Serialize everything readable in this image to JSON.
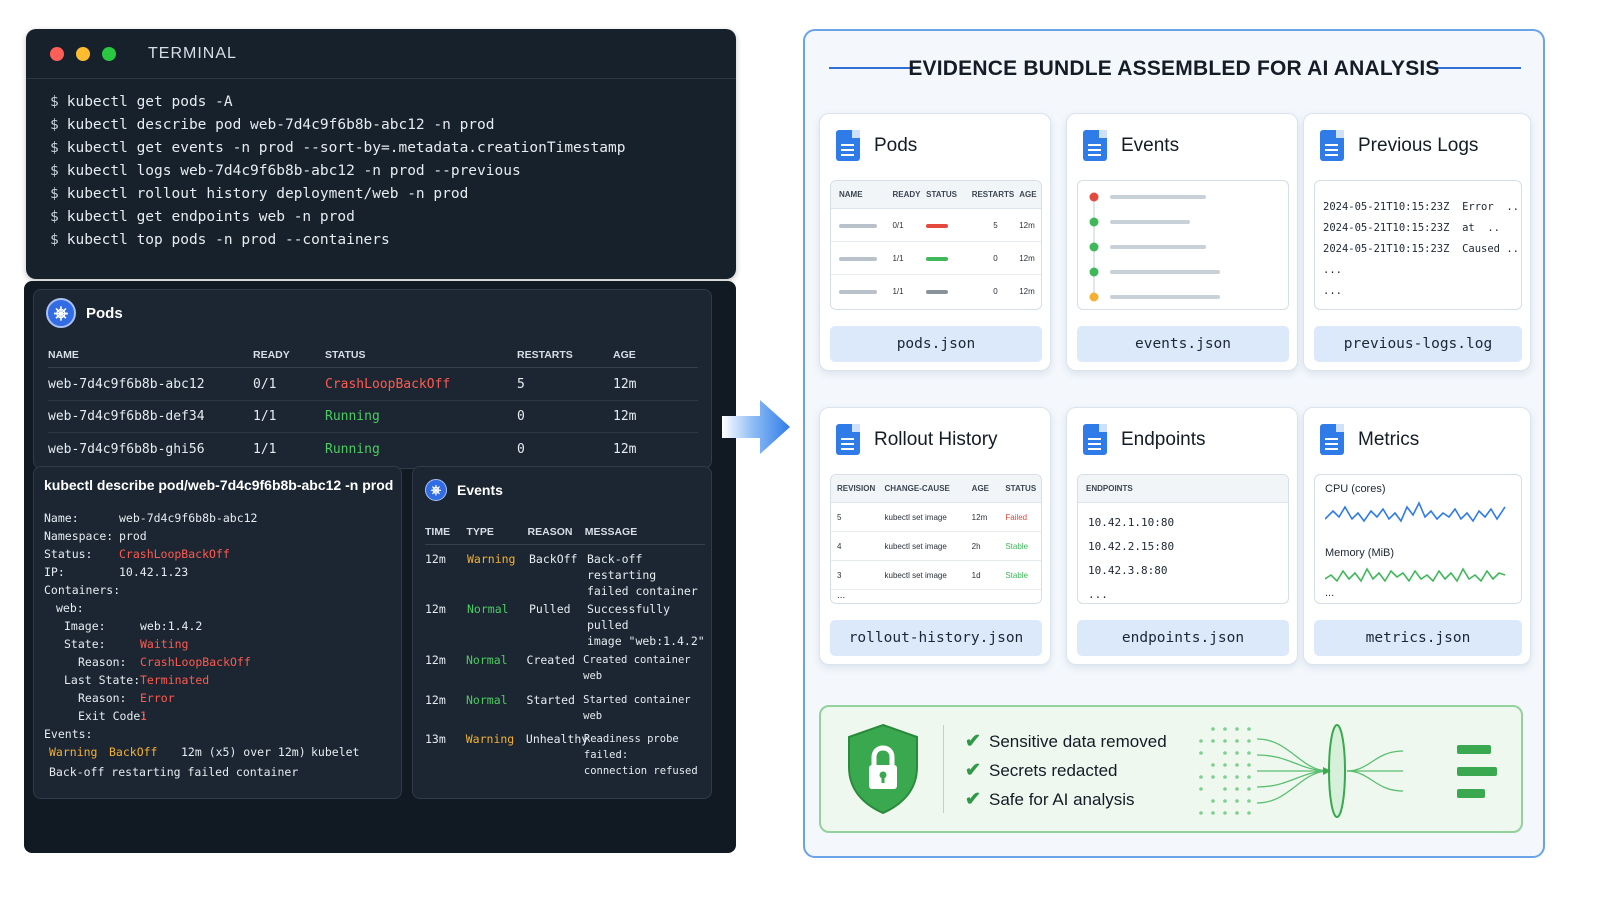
{
  "terminal": {
    "title": "TERMINAL",
    "prompt": "$",
    "commands": [
      "kubectl get pods -A",
      "kubectl describe pod web-7d4c9f6b8b-abc12 -n prod",
      "kubectl get events -n prod --sort-by=.metadata.creationTimestamp",
      "kubectl logs web-7d4c9f6b8b-abc12 -n prod --previous",
      "kubectl rollout history deployment/web -n prod",
      "kubectl get endpoints web -n prod",
      "kubectl top pods -n prod --containers"
    ]
  },
  "pods_panel": {
    "title": "Pods",
    "columns": [
      "NAME",
      "READY",
      "STATUS",
      "RESTARTS",
      "AGE"
    ],
    "rows": [
      {
        "name": "web-7d4c9f6b8b-abc12",
        "ready": "0/1",
        "status": "CrashLoopBackOff",
        "restarts": "5",
        "age": "12m"
      },
      {
        "name": "web-7d4c9f6b8b-def34",
        "ready": "1/1",
        "status": "Running",
        "restarts": "0",
        "age": "12m"
      },
      {
        "name": "web-7d4c9f6b8b-ghi56",
        "ready": "1/1",
        "status": "Running",
        "restarts": "0",
        "age": "12m"
      }
    ]
  },
  "describe_panel": {
    "title": "kubectl describe pod/web-7d4c9f6b8b-abc12 -n prod",
    "name_label": "Name:",
    "name": "web-7d4c9f6b8b-abc12",
    "namespace_label": "Namespace:",
    "namespace": "prod",
    "status_label": "Status:",
    "status": "CrashLoopBackOff",
    "ip_label": "IP:",
    "ip": "10.42.1.23",
    "containers_label": "Containers:",
    "container_name": "web:",
    "image_label": "Image:",
    "image": "web:1.4.2",
    "state_label": "State:",
    "state": "Waiting",
    "reason_label": "Reason:",
    "reason": "CrashLoopBackOff",
    "last_state_label": "Last State:",
    "last_state": "Terminated",
    "last_reason_label": "Reason:",
    "last_reason": "Error",
    "exit_code_label": "Exit Code:",
    "exit_code": "1",
    "events_label": "Events:",
    "event_type": "Warning",
    "event_reason": "BackOff",
    "event_age": "12m (x5) over 12m)",
    "event_from": "kubelet",
    "event_message": "Back-off restarting failed container"
  },
  "events_panel": {
    "title": "Events",
    "columns": [
      "TIME",
      "TYPE",
      "REASON",
      "MESSAGE"
    ],
    "rows": [
      {
        "time": "12m",
        "type": "Warning",
        "reason": "BackOff",
        "message": "Back-off restarting\nfailed container"
      },
      {
        "time": "12m",
        "type": "Normal",
        "reason": "Pulled",
        "message": "Successfully pulled\nimage \"web:1.4.2\""
      },
      {
        "time": "12m",
        "type": "Normal",
        "reason": "Created",
        "message": "Created container web"
      },
      {
        "time": "12m",
        "type": "Normal",
        "reason": "Started",
        "message": "Started container web"
      },
      {
        "time": "13m",
        "type": "Warning",
        "reason": "Unhealthy",
        "message": "Readiness probe failed:\nconnection refused"
      }
    ]
  },
  "bundle": {
    "title": "EVIDENCE BUNDLE ASSEMBLED FOR AI ANALYSIS",
    "cards": {
      "pods": {
        "title": "Pods",
        "file": "pods.json",
        "columns": [
          "NAME",
          "READY",
          "STATUS",
          "RESTARTS",
          "AGE"
        ],
        "rows": [
          {
            "ready": "0/1",
            "restarts": "5",
            "age": "12m",
            "status_color": "#e5483d"
          },
          {
            "ready": "1/1",
            "restarts": "0",
            "age": "12m",
            "status_color": "#3fb85a"
          },
          {
            "ready": "1/1",
            "restarts": "0",
            "age": "12m",
            "status_color": "#8a929b"
          }
        ]
      },
      "events": {
        "title": "Events",
        "file": "events.json",
        "dot_colors": [
          "#e5483d",
          "#3fb85a",
          "#3fb85a",
          "#3fb85a",
          "#f2b134"
        ]
      },
      "logs": {
        "title": "Previous Logs",
        "file": "previous-logs.log",
        "lines": [
          "2024-05-21T10:15:23Z  Error  ...",
          "2024-05-21T10:15:23Z  at  ..",
          "2024-05-21T10:15:23Z  Caused ...",
          "...",
          "..."
        ]
      },
      "rollout": {
        "title": "Rollout History",
        "file": "rollout-history.json",
        "columns": [
          "REVISION",
          "CHANGE-CAUSE",
          "AGE",
          "STATUS"
        ],
        "rows": [
          {
            "revision": "5",
            "cause": "kubectl set image",
            "age": "12m",
            "status": "Failed"
          },
          {
            "revision": "4",
            "cause": "kubectl set image",
            "age": "2h",
            "status": "Stable"
          },
          {
            "revision": "3",
            "cause": "kubectl set image",
            "age": "1d",
            "status": "Stable"
          }
        ],
        "more": "..."
      },
      "endpoints": {
        "title": "Endpoints",
        "file": "endpoints.json",
        "header": "ENDPOINTS",
        "items": [
          "10.42.1.10:80",
          "10.42.2.15:80",
          "10.42.3.8:80"
        ],
        "more": "..."
      },
      "metrics": {
        "title": "Metrics",
        "file": "metrics.json",
        "cpu_label": "CPU (cores)",
        "memory_label": "Memory (MiB)",
        "more": "..."
      }
    },
    "security": {
      "items": [
        "Sensitive data removed",
        "Secrets redacted",
        "Safe for AI analysis"
      ],
      "accent": "#2e9a45"
    }
  },
  "colors": {
    "crash": "#ff5a4e",
    "running": "#4ccb62",
    "warning": "#f2b134",
    "accent_blue": "#2f7be8"
  }
}
